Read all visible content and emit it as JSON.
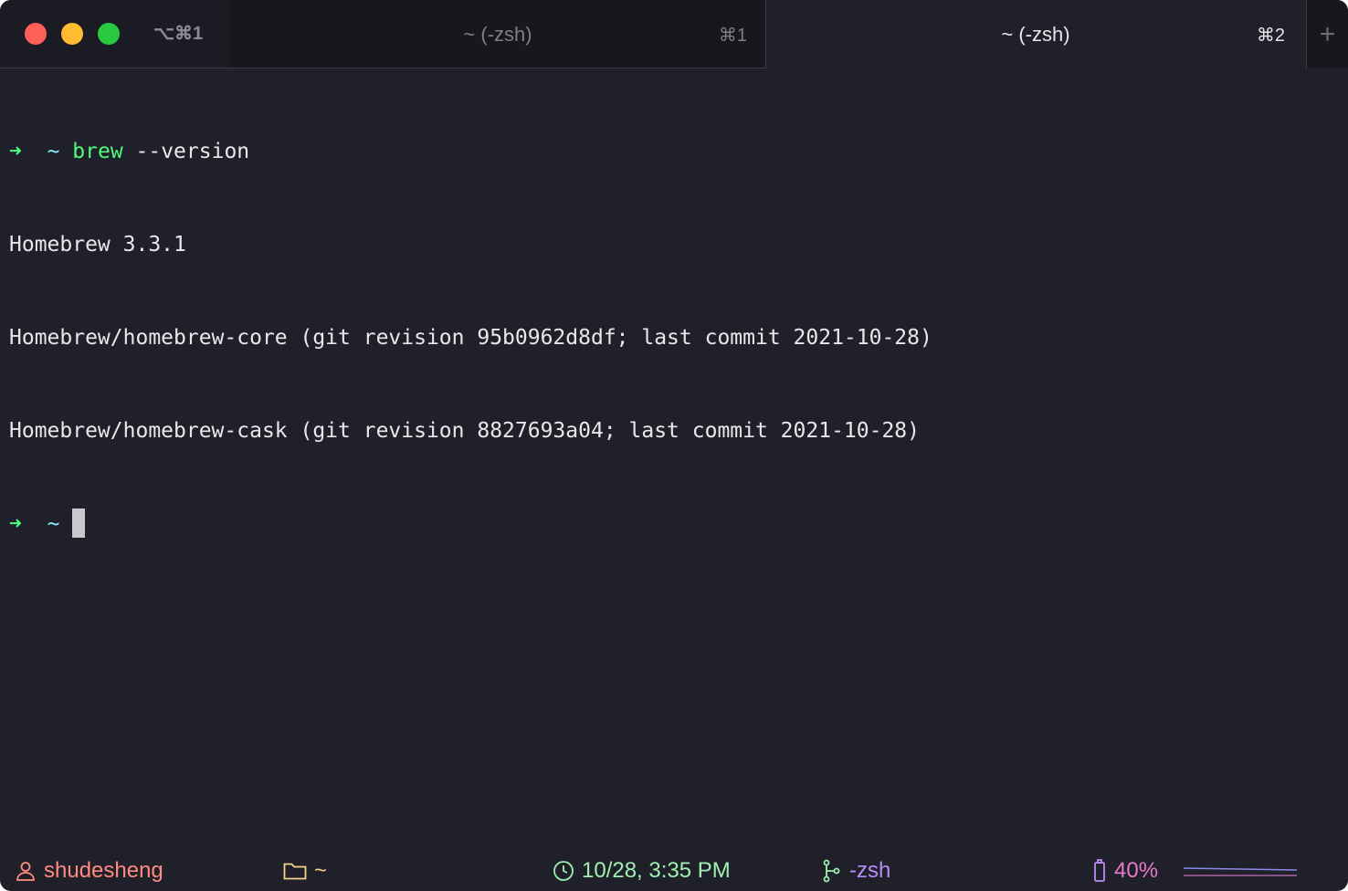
{
  "window": {
    "shortcut": "⌥⌘1"
  },
  "tabs": [
    {
      "title": "~ (-zsh)",
      "shortcut": "⌘1"
    },
    {
      "title": "~ (-zsh)",
      "shortcut": "⌘2"
    }
  ],
  "new_tab_label": "+",
  "terminal": {
    "prompt_arrow": "➜",
    "prompt_dir": "~",
    "command_name": "brew",
    "command_args": " --version",
    "output": [
      "Homebrew 3.3.1",
      "Homebrew/homebrew-core (git revision 95b0962d8df; last commit 2021-10-28)",
      "Homebrew/homebrew-cask (git revision 8827693a04; last commit 2021-10-28)"
    ]
  },
  "status_bar": {
    "user": "shudesheng",
    "directory": "~",
    "datetime": "10/28, 3:35 PM",
    "process": "-zsh",
    "battery": "40%",
    "icons": [
      "user-icon",
      "folder-icon",
      "clock-icon",
      "git-branch-icon",
      "battery-icon"
    ]
  },
  "colors": {
    "background": "#20202a",
    "prompt_green": "#50fa7b",
    "prompt_cyan": "#8be9fd",
    "user_red": "#ff8a80",
    "dir_yellow": "#f1d38a",
    "time_green": "#9ef0b0",
    "proc_purple": "#b78cf5",
    "battery_pink": "#e879c8"
  }
}
